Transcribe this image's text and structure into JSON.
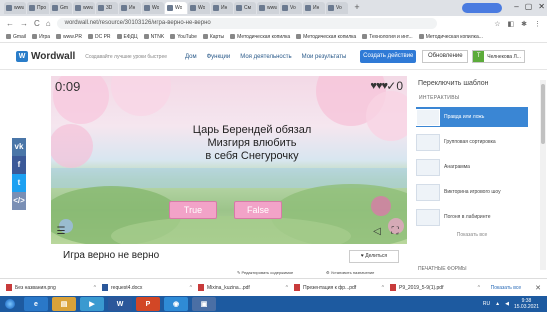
{
  "browser": {
    "tabs": [
      {
        "label": "www"
      },
      {
        "label": "Про"
      },
      {
        "label": "Gm"
      },
      {
        "label": "www"
      },
      {
        "label": "3D"
      },
      {
        "label": "Ин"
      },
      {
        "label": "Wo"
      },
      {
        "label": "Wo"
      },
      {
        "label": "Wo"
      },
      {
        "label": "Ин"
      },
      {
        "label": "См"
      },
      {
        "label": "www"
      },
      {
        "label": "Vo"
      },
      {
        "label": "Ин"
      },
      {
        "label": "Vo"
      }
    ],
    "url": "wordwall.net/resource/30103126/игра-верно-не-верно",
    "bookmarks": [
      "Gmail",
      "Игра",
      "www.PR",
      "DC PR",
      "ЕФДЦ",
      "NTNK",
      "YouTube",
      "Карты",
      "Методическая копилка",
      "Методическая копилка",
      "Технология и инт...",
      "Методическая копилка..."
    ]
  },
  "header": {
    "logo_text": "Wordwall",
    "tagline": "Создавайте лучшие уроки быстрее",
    "nav": [
      "Дом",
      "Функции",
      "Моя деятельность",
      "Мои результаты"
    ],
    "create_label": "Создать действие",
    "update_label": "Обновление",
    "user_initial": "T",
    "user_name": "Челнекова Л..."
  },
  "social": [
    {
      "label": "vk",
      "color": "#4a76a8"
    },
    {
      "label": "f",
      "color": "#3b5998"
    },
    {
      "label": "t",
      "color": "#1da1f2"
    },
    {
      "label": "</>",
      "color": "#7a8fb5"
    }
  ],
  "game": {
    "timer": "0:09",
    "lives": "♥♥♥",
    "score": "✓0",
    "question_lines": [
      "Царь Берендей обязал",
      "Мизгиря влюбить",
      "в себя Снегурочку"
    ],
    "answer_true": "True",
    "answer_false": "False"
  },
  "footer": {
    "title": "Игра верно не верно",
    "like_label": "♥ Делиться",
    "edit_label": "✎ Редактировать содержимое",
    "assign_label": "⚙ Установить назначение"
  },
  "right_panel": {
    "title": "Переключить шаблон",
    "subtitle": "ИНТЕРАКТИВЫ",
    "templates": [
      {
        "label": "Правда или ложь",
        "selected": true
      },
      {
        "label": "Групповая сортировка",
        "selected": false
      },
      {
        "label": "Анаграмма",
        "selected": false
      },
      {
        "label": "Викторина игрового шоу",
        "selected": false
      },
      {
        "label": "Погоня в лабиринте",
        "selected": false
      }
    ],
    "more_label": "Показать все",
    "bottom_label": "ПЕЧАТНЫЕ ФОРМЫ"
  },
  "downloads": {
    "items": [
      "Без названия.png",
      "request4.docx",
      "Mixina_kuzina...pdf",
      "Презентация к фр...pdf",
      "P9_2019_5-9(1).pdf"
    ],
    "show_all": "Показать все",
    "close": "✕"
  },
  "taskbar": {
    "apps": [
      {
        "label": "e",
        "color": "#2a78c8"
      },
      {
        "label": "▤",
        "color": "#d9a23a"
      },
      {
        "label": "▶",
        "color": "#3a9ad0"
      },
      {
        "label": "W",
        "color": "#2b579a"
      },
      {
        "label": "P",
        "color": "#d24726"
      },
      {
        "label": "◉",
        "color": "#2f8bd6"
      },
      {
        "label": "▣",
        "color": "#4a6fa5"
      }
    ],
    "tray": "RU",
    "time": "9:38",
    "date": "15.03.2021"
  }
}
